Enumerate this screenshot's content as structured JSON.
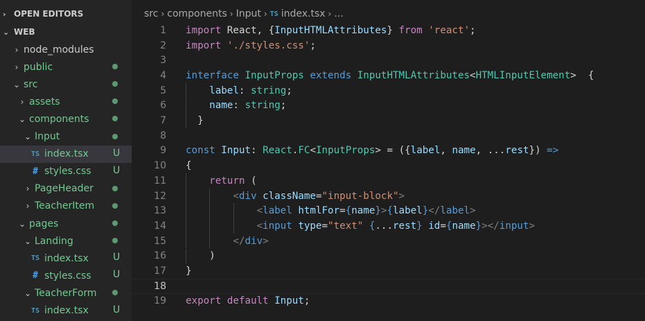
{
  "sidebar": {
    "open_editors_label": "OPEN EDITORS",
    "workspace_label": "WEB",
    "items": [
      {
        "label": "node_modules",
        "chevron": "›",
        "status": ""
      },
      {
        "label": "public",
        "chevron": "›",
        "status": "dot"
      },
      {
        "label": "src",
        "chevron": "⌄",
        "status": "dot"
      },
      {
        "label": "assets",
        "chevron": "›",
        "status": "dot"
      },
      {
        "label": "components",
        "chevron": "⌄",
        "status": "dot"
      },
      {
        "label": "Input",
        "chevron": "⌄",
        "status": "dot"
      },
      {
        "label": "index.tsx",
        "file_icon": "TS",
        "status": "U"
      },
      {
        "label": "styles.css",
        "file_icon": "#",
        "status": "U"
      },
      {
        "label": "PageHeader",
        "chevron": "›",
        "status": "dot"
      },
      {
        "label": "TeacherItem",
        "chevron": "›",
        "status": "dot"
      },
      {
        "label": "pages",
        "chevron": "⌄",
        "status": "dot"
      },
      {
        "label": "Landing",
        "chevron": "⌄",
        "status": "dot"
      },
      {
        "label": "index.tsx",
        "file_icon": "TS",
        "status": "U"
      },
      {
        "label": "styles.css",
        "file_icon": "#",
        "status": "U"
      },
      {
        "label": "TeacherForm",
        "chevron": "⌄",
        "status": "dot"
      },
      {
        "label": "index.tsx",
        "file_icon": "TS",
        "status": "U"
      }
    ]
  },
  "breadcrumb": {
    "parts": [
      "src",
      "components",
      "Input"
    ],
    "file_icon": "TS",
    "file": "index.tsx",
    "tail": "..."
  },
  "editor": {
    "current_line": 18,
    "lines": [
      {
        "n": "1"
      },
      {
        "n": "2"
      },
      {
        "n": "3"
      },
      {
        "n": "4"
      },
      {
        "n": "5"
      },
      {
        "n": "6"
      },
      {
        "n": "7"
      },
      {
        "n": "8"
      },
      {
        "n": "9"
      },
      {
        "n": "10"
      },
      {
        "n": "11"
      },
      {
        "n": "12"
      },
      {
        "n": "13"
      },
      {
        "n": "14"
      },
      {
        "n": "15"
      },
      {
        "n": "16"
      },
      {
        "n": "17"
      },
      {
        "n": "18"
      },
      {
        "n": "19"
      }
    ],
    "code": [
      [
        [
          "kc",
          "import"
        ],
        [
          "pu",
          " React, {"
        ],
        [
          "va",
          "InputHTMLAttributes"
        ],
        [
          "pu",
          "} "
        ],
        [
          "kc",
          "from"
        ],
        [
          "pu",
          " "
        ],
        [
          "st",
          "'react'"
        ],
        [
          "pu",
          ";"
        ]
      ],
      [
        [
          "kc",
          "import"
        ],
        [
          "pu",
          " "
        ],
        [
          "st",
          "'./styles.css'"
        ],
        [
          "pu",
          ";"
        ]
      ],
      [],
      [
        [
          "kw",
          "interface"
        ],
        [
          "pu",
          " "
        ],
        [
          "ty",
          "InputProps"
        ],
        [
          "pu",
          " "
        ],
        [
          "kw",
          "extends"
        ],
        [
          "pu",
          " "
        ],
        [
          "ty",
          "InputHTMLAttributes"
        ],
        [
          "pu",
          "<"
        ],
        [
          "ty",
          "HTMLInputElement"
        ],
        [
          "pu",
          ">  {"
        ]
      ],
      [
        [
          "pu",
          "    "
        ],
        [
          "va",
          "label"
        ],
        [
          "pu",
          ": "
        ],
        [
          "ty",
          "string"
        ],
        [
          "pu",
          ";"
        ]
      ],
      [
        [
          "pu",
          "    "
        ],
        [
          "va",
          "name"
        ],
        [
          "pu",
          ": "
        ],
        [
          "ty",
          "string"
        ],
        [
          "pu",
          ";"
        ]
      ],
      [
        [
          "pu",
          "  }"
        ]
      ],
      [],
      [
        [
          "kw",
          "const"
        ],
        [
          "pu",
          " "
        ],
        [
          "va",
          "Input"
        ],
        [
          "pu",
          ": "
        ],
        [
          "ty",
          "React"
        ],
        [
          "pu",
          "."
        ],
        [
          "ty",
          "FC"
        ],
        [
          "pu",
          "<"
        ],
        [
          "ty",
          "InputProps"
        ],
        [
          "pu",
          "> = ({"
        ],
        [
          "va",
          "label"
        ],
        [
          "pu",
          ", "
        ],
        [
          "va",
          "name"
        ],
        [
          "pu",
          ", ..."
        ],
        [
          "va",
          "rest"
        ],
        [
          "pu",
          "}) "
        ],
        [
          "kw",
          "=>"
        ]
      ],
      [
        [
          "pu",
          "{"
        ]
      ],
      [
        [
          "pu",
          "    "
        ],
        [
          "kc",
          "return"
        ],
        [
          "pu",
          " ("
        ]
      ],
      [
        [
          "pu",
          "        "
        ],
        [
          "tg",
          "<"
        ],
        [
          "te",
          "div"
        ],
        [
          "pu",
          " "
        ],
        [
          "va",
          "className"
        ],
        [
          "pu",
          "="
        ],
        [
          "st",
          "\"input-block\""
        ],
        [
          "tg",
          ">"
        ]
      ],
      [
        [
          "pu",
          "            "
        ],
        [
          "tg",
          "<"
        ],
        [
          "te",
          "label"
        ],
        [
          "pu",
          " "
        ],
        [
          "va",
          "htmlFor"
        ],
        [
          "pu",
          "="
        ],
        [
          "kw",
          "{"
        ],
        [
          "va",
          "name"
        ],
        [
          "kw",
          "}"
        ],
        [
          "tg",
          ">"
        ],
        [
          "kw",
          "{"
        ],
        [
          "va",
          "label"
        ],
        [
          "kw",
          "}"
        ],
        [
          "tg",
          "</"
        ],
        [
          "te",
          "label"
        ],
        [
          "tg",
          ">"
        ]
      ],
      [
        [
          "pu",
          "            "
        ],
        [
          "tg",
          "<"
        ],
        [
          "te",
          "input"
        ],
        [
          "pu",
          " "
        ],
        [
          "va",
          "type"
        ],
        [
          "pu",
          "="
        ],
        [
          "st",
          "\"text\""
        ],
        [
          "pu",
          " "
        ],
        [
          "kw",
          "{"
        ],
        [
          "pu",
          "..."
        ],
        [
          "va",
          "rest"
        ],
        [
          "kw",
          "}"
        ],
        [
          "pu",
          " "
        ],
        [
          "va",
          "id"
        ],
        [
          "pu",
          "="
        ],
        [
          "kw",
          "{"
        ],
        [
          "va",
          "name"
        ],
        [
          "kw",
          "}"
        ],
        [
          "tg",
          "></"
        ],
        [
          "te",
          "input"
        ],
        [
          "tg",
          ">"
        ]
      ],
      [
        [
          "pu",
          "        "
        ],
        [
          "tg",
          "</"
        ],
        [
          "te",
          "div"
        ],
        [
          "tg",
          ">"
        ]
      ],
      [
        [
          "pu",
          "    )"
        ]
      ],
      [
        [
          "pu",
          "}"
        ]
      ],
      [],
      [
        [
          "kc",
          "export"
        ],
        [
          "pu",
          " "
        ],
        [
          "kc",
          "default"
        ],
        [
          "pu",
          " "
        ],
        [
          "va",
          "Input"
        ],
        [
          "pu",
          ";"
        ]
      ]
    ]
  }
}
